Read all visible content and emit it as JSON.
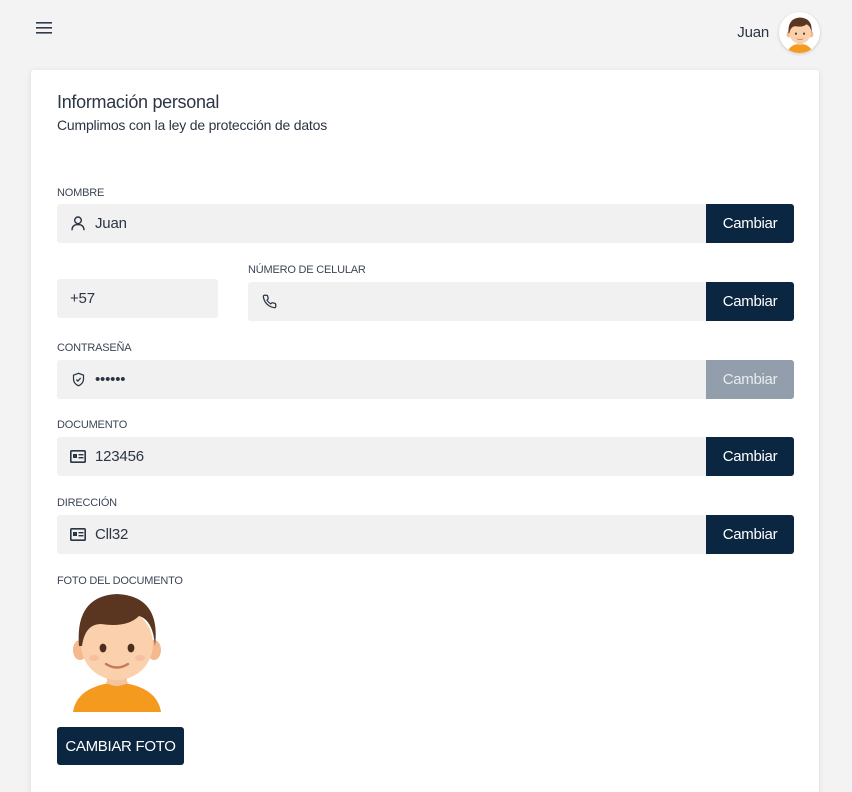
{
  "header": {
    "menu_icon": "hamburger-menu-icon",
    "user_name": "Juan",
    "avatar_icon": "user-avatar-icon"
  },
  "card": {
    "title": "Información personal",
    "subtitle": "Cumplimos con la ley de protección de datos"
  },
  "fields": {
    "nombre": {
      "label": "NOMBRE",
      "value": "Juan",
      "icon": "user-icon",
      "button": "Cambiar"
    },
    "telefono": {
      "prefix": "+57",
      "label": "NÚMERO DE CELULAR",
      "value": "",
      "icon": "phone-icon",
      "button": "Cambiar"
    },
    "contrasena": {
      "label": "CONTRASEÑA",
      "value": "••••••",
      "icon": "shield-icon",
      "button": "Cambiar",
      "button_disabled": true
    },
    "documento": {
      "label": "DOCUMENTO",
      "value": "123456",
      "icon": "id-card-icon",
      "button": "Cambiar"
    },
    "direccion": {
      "label": "DIRECCIÓN",
      "value": "Cll32",
      "icon": "id-card-icon",
      "button": "Cambiar"
    }
  },
  "photo": {
    "label": "FOTO DEL DOCUMENTO",
    "image": "boy-avatar-illustration",
    "button": "CAMBIAR FOTO"
  },
  "colors": {
    "primary": "#0b2640",
    "disabled": "#929eab",
    "input_bg": "#f1f1f1",
    "page_bg": "#f3f3f3"
  }
}
